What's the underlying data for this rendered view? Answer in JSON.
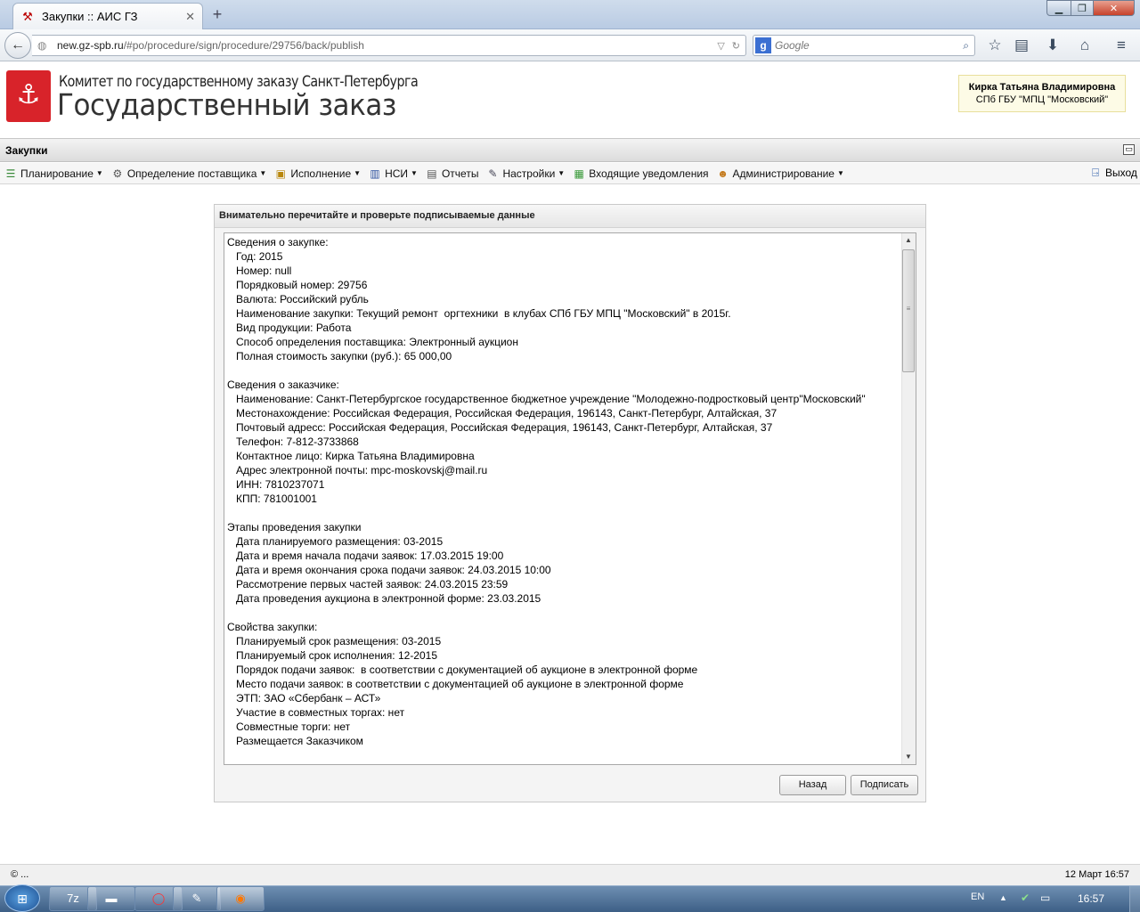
{
  "browser": {
    "tab_title": "Закупки :: АИС ГЗ",
    "url_host": "new.gz-spb.ru",
    "url_path": "/#po/procedure/sign/procedure/29756/back/publish",
    "search_placeholder": "Google"
  },
  "header": {
    "org_line1": "Комитет по государственному заказу Санкт-Петербурга",
    "org_line2": "Государственный заказ",
    "user_name": "Кирка Татьяна Владимировна",
    "user_org": "СПб ГБУ \"МПЦ \"Московский\""
  },
  "section_title": "Закупки",
  "menu": [
    {
      "label": "Планирование",
      "icon": "planning-icon"
    },
    {
      "label": "Определение поставщика",
      "icon": "gear-icon"
    },
    {
      "label": "Исполнение",
      "icon": "briefcase-icon"
    },
    {
      "label": "НСИ",
      "icon": "book-icon"
    },
    {
      "label": "Отчеты",
      "icon": "report-icon"
    },
    {
      "label": "Настройки",
      "icon": "wrench-icon"
    },
    {
      "label": "Входящие уведомления",
      "icon": "inbox-icon"
    },
    {
      "label": "Администрирование",
      "icon": "user-icon"
    }
  ],
  "logout_label": "Выход",
  "dialog": {
    "title": "Внимательно перечитайте и проверьте подписываемые данные",
    "content_lines": [
      "Сведения о закупке:",
      "   Год: 2015",
      "   Номер: null",
      "   Порядковый номер: 29756",
      "   Валюта: Российский рубль",
      "   Наименование закупки: Текущий ремонт  оргтехники  в клубах СПб ГБУ МПЦ \"Московский\" в 2015г.",
      "   Вид продукции: Работа",
      "   Способ определения поставщика: Электронный аукцион",
      "   Полная стоимость закупки (руб.): 65 000,00",
      "",
      "Сведения о заказчике:",
      "   Наименование: Санкт-Петербургское государственное бюджетное учреждение \"Молодежно-подростковый центр\"Московский\"",
      "   Местонахождение: Российская Федерация, Российская Федерация, 196143, Санкт-Петербург, Алтайская, 37",
      "   Почтовый адресс: Российская Федерация, Российская Федерация, 196143, Санкт-Петербург, Алтайская, 37",
      "   Телефон: 7-812-3733868",
      "   Контактное лицо: Кирка Татьяна Владимировна",
      "   Адрес электронной почты: mpc-moskovskj@mail.ru",
      "   ИНН: 7810237071",
      "   КПП: 781001001",
      "",
      "Этапы проведения закупки",
      "   Дата планируемого размещения: 03-2015",
      "   Дата и время начала подачи заявок: 17.03.2015 19:00",
      "   Дата и время окончания срока подачи заявок: 24.03.2015 10:00",
      "   Рассмотрение первых частей заявок: 24.03.2015 23:59",
      "   Дата проведения аукциона в электронной форме: 23.03.2015",
      "",
      "Свойства закупки:",
      "   Планируемый срок размещения: 03-2015",
      "   Планируемый срок исполнения: 12-2015",
      "   Порядок подачи заявок:  в соответствии с документацией об аукционе в электронной форме",
      "   Место подачи заявок: в соответствии с документацией об аукционе в электронной форме",
      "   ЭТП: ЗАО «Сбербанк – АСТ»",
      "   Участие в совместных торгах: нет",
      "   Совместные торги: нет",
      "   Размещается Заказчиком"
    ],
    "back_button": "Назад",
    "sign_button": "Подписать"
  },
  "status": {
    "left": "© ...",
    "right": "12 Март 16:57"
  },
  "taskbar": {
    "lang": "EN",
    "clock": "16:57"
  }
}
